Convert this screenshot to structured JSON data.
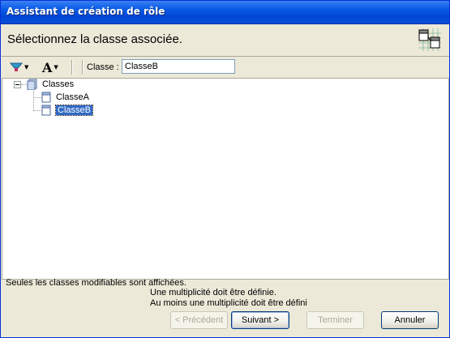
{
  "window": {
    "title": "Assistant de création de rôle"
  },
  "header": {
    "instruction": "Sélectionnez la classe associée.",
    "icon": "class-wizard-icon"
  },
  "toolbar": {
    "filter_icon": "filter-icon",
    "font_icon": "font-icon",
    "classe_label": "Classe :",
    "classe_value": "ClasseB"
  },
  "tree": {
    "root": "Classes",
    "items": [
      {
        "label": "ClasseA",
        "selected": false
      },
      {
        "label": "ClasseB",
        "selected": true
      }
    ]
  },
  "status": {
    "info": "Seules les classes modifiables sont affichées.",
    "messages": [
      "Une multiplicité doit être définie.",
      "Au moins une multiplicité doit être défini"
    ]
  },
  "buttons": {
    "previous": "< Précédent",
    "next": "Suivant >",
    "finish": "Terminer",
    "cancel": "Annuler"
  },
  "colors": {
    "titlebar": "#0A5DE8",
    "selection": "#316AC5",
    "dialog_bg": "#ECE9D8"
  }
}
